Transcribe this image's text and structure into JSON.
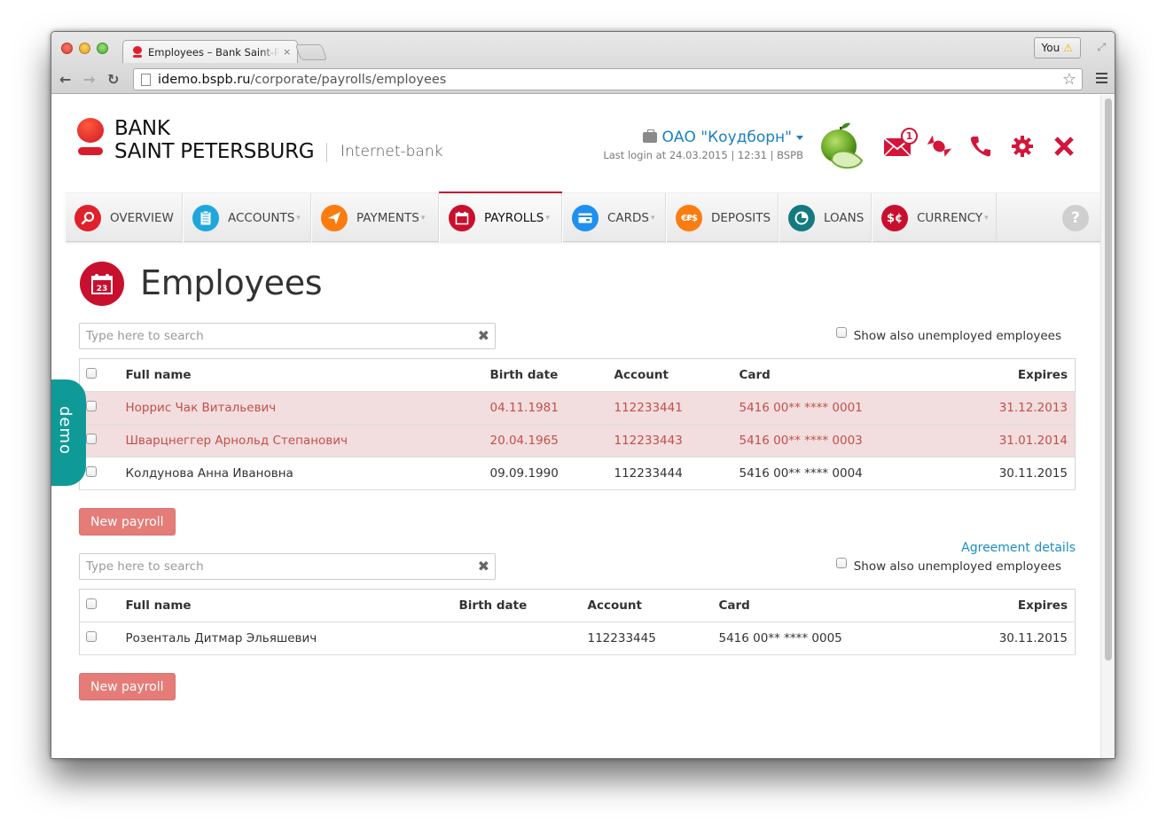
{
  "browser": {
    "tab_title": "Employees – Bank Saint-Petersburg",
    "tab_close": "×",
    "url_host": "idemo.bspb.ru",
    "url_path": "/corporate/payrolls/employees",
    "profile_label": "You",
    "profile_warning": "⚠"
  },
  "header": {
    "logo_line1": "BANK",
    "logo_line2": "SAINT PETERSBURG",
    "product": "Internet-bank",
    "company_name": "ОАО \"Коудборн\"",
    "last_login": "Last login at 24.03.2015 | 12:31 | BSPB",
    "mail_badge": "1",
    "icons": [
      "mail-icon",
      "candy-icon",
      "phone-icon",
      "gear-icon",
      "close-icon"
    ]
  },
  "nav": {
    "items": [
      {
        "label": "OVERVIEW",
        "icon": "search-icon",
        "color": "#e0202b",
        "dropdown": false,
        "active": false
      },
      {
        "label": "ACCOUNTS",
        "icon": "clipboard-icon",
        "color": "#1fa7dd",
        "dropdown": true,
        "active": false
      },
      {
        "label": "PAYMENTS",
        "icon": "paper-plane-icon",
        "color": "#fb7c10",
        "dropdown": true,
        "active": false
      },
      {
        "label": "PAYROLLS",
        "icon": "calendar-icon",
        "color": "#c8102e",
        "dropdown": true,
        "active": true
      },
      {
        "label": "CARDS",
        "icon": "card-icon",
        "color": "#1e90f0",
        "dropdown": true,
        "active": false
      },
      {
        "label": "DEPOSITS",
        "icon": "currency-icon",
        "color": "#fb7c10",
        "dropdown": false,
        "active": false
      },
      {
        "label": "LOANS",
        "icon": "pie-icon",
        "color": "#137a80",
        "dropdown": false,
        "active": false
      },
      {
        "label": "CURRENCY",
        "icon": "dollar-cent-icon",
        "color": "#c8102e",
        "dropdown": true,
        "active": false
      }
    ],
    "help": "?",
    "dropdown_glyph": "▾",
    "currency_glyph": "€₽$",
    "dollar_glyph": "$¢"
  },
  "page": {
    "title": "Employees",
    "calendar_day": "23",
    "demo_label": "demo",
    "agreement_link": "Agreement details"
  },
  "groups": [
    {
      "search_placeholder": "Type here to search",
      "search_value": "",
      "unemployed_label": "Show also unemployed employees",
      "unemployed_checked": false,
      "columns": [
        "Full name",
        "Birth date",
        "Account",
        "Card",
        "Expires"
      ],
      "rows": [
        {
          "name": "Норрис Чак Витальевич",
          "birth": "04.11.1981",
          "account": "112233441",
          "card": "5416 00** **** 0001",
          "expires": "31.12.2013",
          "expired": true
        },
        {
          "name": "Шварцнеггер Арнольд Степанович",
          "birth": "20.04.1965",
          "account": "112233443",
          "card": "5416 00** **** 0003",
          "expires": "31.01.2014",
          "expired": true
        },
        {
          "name": "Колдунова Анна Ивановна",
          "birth": "09.09.1990",
          "account": "112233444",
          "card": "5416 00** **** 0004",
          "expires": "30.11.2015",
          "expired": false
        }
      ],
      "button": "New payroll"
    },
    {
      "search_placeholder": "Type here to search",
      "search_value": "",
      "unemployed_label": "Show also unemployed employees",
      "unemployed_checked": false,
      "columns": [
        "Full name",
        "Birth date",
        "Account",
        "Card",
        "Expires"
      ],
      "rows": [
        {
          "name": "Розенталь Дитмар Эльяшевич",
          "birth": "",
          "account": "112233445",
          "card": "5416 00** **** 0005",
          "expires": "30.11.2015",
          "expired": false
        }
      ],
      "button": "New payroll"
    }
  ]
}
